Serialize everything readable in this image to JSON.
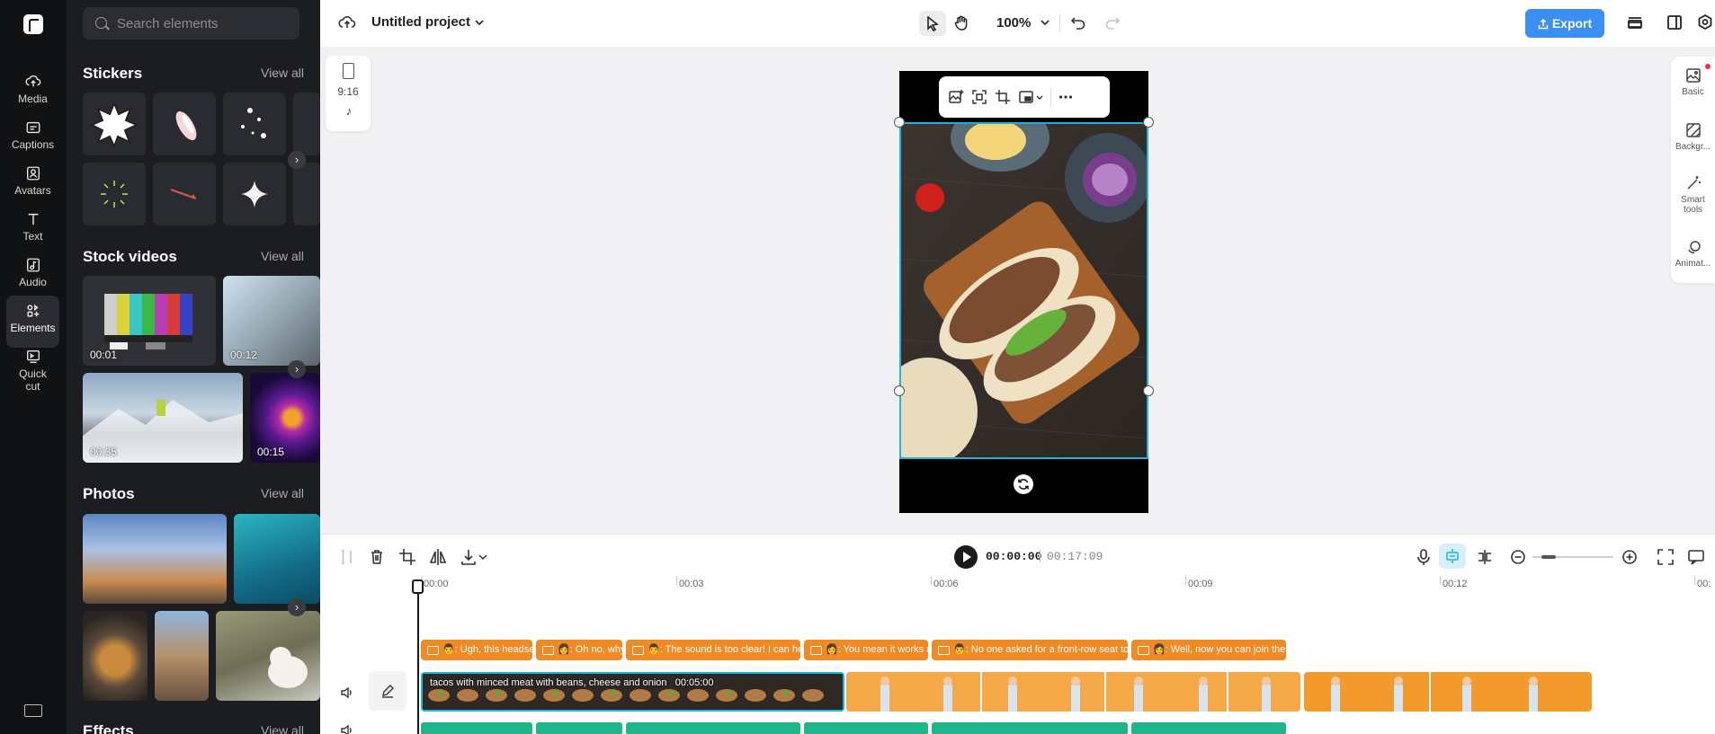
{
  "rail": {
    "items": [
      {
        "label": "Media",
        "icon": "cloud-upload-icon"
      },
      {
        "label": "Captions",
        "icon": "captions-icon"
      },
      {
        "label": "Avatars",
        "icon": "avatar-icon"
      },
      {
        "label": "Text",
        "icon": "text-icon"
      },
      {
        "label": "Audio",
        "icon": "music-icon"
      },
      {
        "label": "Elements",
        "icon": "elements-icon",
        "active": true
      },
      {
        "label": "Quick cut",
        "icon": "quick-cut-icon"
      }
    ]
  },
  "panel": {
    "search_placeholder": "Search elements",
    "sections": {
      "stickers": {
        "title": "Stickers",
        "view_all": "View all"
      },
      "stock_videos": {
        "title": "Stock videos",
        "view_all": "View all",
        "durations": [
          "00:01",
          "00:12",
          "00:35",
          "00:15"
        ]
      },
      "photos": {
        "title": "Photos",
        "view_all": "View all"
      },
      "effects": {
        "title": "Effects",
        "view_all": "View all"
      }
    }
  },
  "topbar": {
    "project_title": "Untitled project",
    "zoom": "100%",
    "export_label": "Export"
  },
  "canvas": {
    "aspect_ratio": "9:16"
  },
  "right_rail": {
    "items": [
      "Basic",
      "Backgr...",
      "Smart tools",
      "Animat..."
    ]
  },
  "timeline": {
    "current_time": "00:00:00",
    "duration": "00:17:09",
    "ruler_labels": [
      "00:00",
      "00:03",
      "00:06",
      "00:09",
      "00:12",
      "00:"
    ],
    "captions": [
      "👨: Ugh, this headset",
      "👩: Oh no, why",
      "👨: The sound is too clear! I can hear",
      "👩: You mean it works as",
      "👨: No one asked for a front-row seat to fi",
      "👩: Well, now you can join their"
    ],
    "video_clip": {
      "label": "tacos with minced meat with beans, cheese and onion",
      "duration": "00:05:00"
    }
  },
  "colors": {
    "accent": "#3b8ef2",
    "selection": "#1fb6d8",
    "caption_clip": "#f08a24",
    "audio_clip": "#1fb58a",
    "sidebar_bg": "#1c1d21"
  }
}
